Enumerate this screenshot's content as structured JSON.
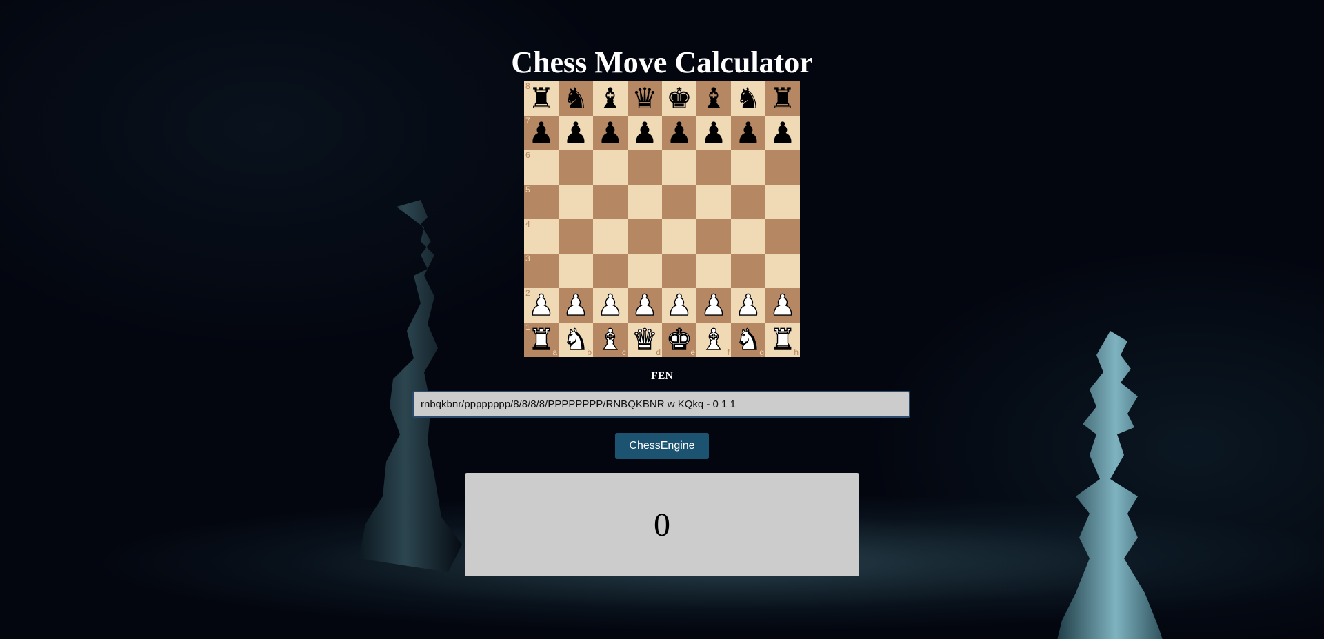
{
  "page": {
    "title": "Chess Move Calculator"
  },
  "board": {
    "ranks": [
      "8",
      "7",
      "6",
      "5",
      "4",
      "3",
      "2",
      "1"
    ],
    "files": [
      "a",
      "b",
      "c",
      "d",
      "e",
      "f",
      "g",
      "h"
    ],
    "position": [
      [
        "br",
        "bn",
        "bb",
        "bq",
        "bk",
        "bb",
        "bn",
        "br"
      ],
      [
        "bp",
        "bp",
        "bp",
        "bp",
        "bp",
        "bp",
        "bp",
        "bp"
      ],
      [
        "",
        "",
        "",
        "",
        "",
        "",
        "",
        ""
      ],
      [
        "",
        "",
        "",
        "",
        "",
        "",
        "",
        ""
      ],
      [
        "",
        "",
        "",
        "",
        "",
        "",
        "",
        ""
      ],
      [
        "",
        "",
        "",
        "",
        "",
        "",
        "",
        ""
      ],
      [
        "wp",
        "wp",
        "wp",
        "wp",
        "wp",
        "wp",
        "wp",
        "wp"
      ],
      [
        "wr",
        "wn",
        "wb",
        "wq",
        "wk",
        "wb",
        "wn",
        "wr"
      ]
    ],
    "colors": {
      "light_square": "#f0d9b5",
      "dark_square": "#b58863"
    }
  },
  "fen": {
    "label": "FEN",
    "value": "rnbqkbnr/pppppppp/8/8/8/8/PPPPPPPP/RNBQKBNR w KQkq - 0 1 1"
  },
  "engine_button": {
    "label": "ChessEngine"
  },
  "result": {
    "value": "0"
  },
  "background": {
    "description_icons": [
      "black-king-icon",
      "white-king-icon"
    ],
    "accent": "#1b5370"
  }
}
